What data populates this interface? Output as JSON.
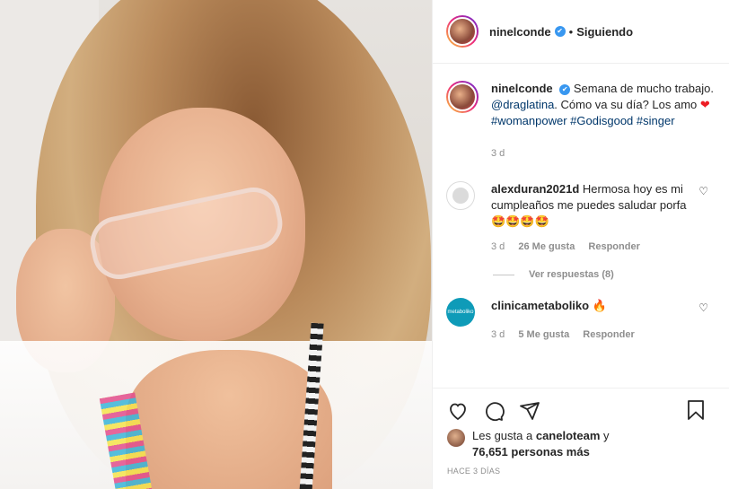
{
  "header": {
    "username": "ninelconde",
    "separator": "•",
    "follow_status": "Siguiendo"
  },
  "caption": {
    "username": "ninelconde",
    "text_1": "Semana de mucho trabajo.",
    "mention": "@draglatina",
    "text_2": ". Cómo va su día? Los amo",
    "heart": "❤",
    "tag_1": "#womanpower",
    "tag_2": "#Godisgood",
    "tag_3": "#singer",
    "time": "3 d"
  },
  "comments": [
    {
      "username": "alexduran2021d",
      "text": "Hermosa hoy es mi cumpleaños me puedes saludar porfa🤩🤩🤩🤩",
      "time": "3 d",
      "likes": "26 Me gusta",
      "reply": "Responder",
      "view_replies": "Ver respuestas (8)"
    },
    {
      "username": "clinicametaboliko",
      "text": "🔥",
      "time": "3 d",
      "likes": "5 Me gusta",
      "reply": "Responder",
      "avatar_text": "metaboliko"
    }
  ],
  "likes": {
    "prefix": "Les gusta a",
    "user": "caneloteam",
    "suffix": "y",
    "count": "76,651 personas más"
  },
  "date": "HACE 3 DÍAS",
  "icons": [
    "heart-icon",
    "comment-icon",
    "share-icon",
    "bookmark-icon",
    "verified-icon"
  ],
  "colors": {
    "link": "#00376b",
    "verified": "#3897f0",
    "heart": "#ed1c24"
  }
}
